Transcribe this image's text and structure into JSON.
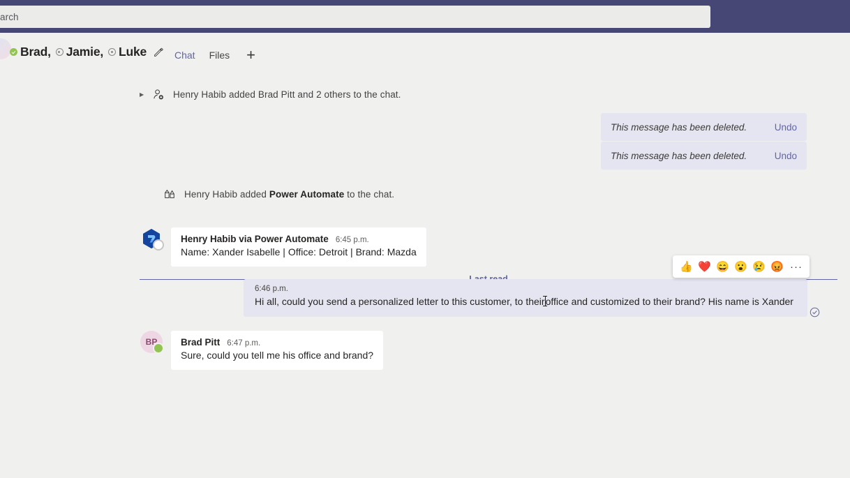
{
  "topbar": {
    "search": {
      "placeholder": "arch",
      "name": "search"
    },
    "accent_color": "#464775"
  },
  "chat_header": {
    "participants": [
      {
        "name": "Brad,",
        "presence": "available"
      },
      {
        "name": "Jamie,",
        "presence": "offline"
      },
      {
        "name": "Luke",
        "presence": "offline"
      }
    ],
    "edit_icon": "pencil-icon",
    "tabs": [
      {
        "label": "Chat",
        "active": true
      },
      {
        "label": "Files",
        "active": false
      }
    ],
    "add_tab_label": "+"
  },
  "messages": {
    "system_1": {
      "prefix": "Henry Habib added ",
      "bold": "Brad Pitt",
      "suffix": " and 2 others to the chat.",
      "full": "Henry Habib added Brad Pitt and 2 others to the chat.",
      "icon": "add-person-icon"
    },
    "system_2": {
      "prefix": "Henry Habib added ",
      "bold": "Power Automate",
      "suffix": " to the chat.",
      "icon": "app-icon"
    },
    "deleted_1": {
      "text": "This message has been deleted.",
      "undo": "Undo"
    },
    "deleted_2": {
      "text": "This message has been deleted.",
      "undo": "Undo"
    },
    "last_read": "Last read",
    "bot_message": {
      "sender": "Henry Habib via Power Automate",
      "time": "6:45 p.m.",
      "body": "Name: Xander Isabelle | Office: Detroit | Brand: Mazda",
      "avatar": "power-automate-logo",
      "presence": "unknown"
    },
    "outgoing": {
      "time": "6:46 p.m.",
      "body_before_caret": "Hi all, could you send a personalized letter to this customer, to their",
      "body_after_caret": "office and customized to their brand? His name is Xander",
      "seen_icon": "seen-check-icon"
    },
    "reply": {
      "sender": "Brad Pitt",
      "time": "6:47 p.m.",
      "body": "Sure, could you tell me his office and brand?",
      "avatar_initials": "BP",
      "presence": "available"
    }
  },
  "reaction_bar": {
    "reactions": [
      {
        "name": "thumbs-up-reaction",
        "glyph": "👍"
      },
      {
        "name": "heart-reaction",
        "glyph": "❤️"
      },
      {
        "name": "laugh-reaction",
        "glyph": "😄"
      },
      {
        "name": "surprised-reaction",
        "glyph": "😮"
      },
      {
        "name": "sad-reaction",
        "glyph": "😢"
      },
      {
        "name": "angry-reaction",
        "glyph": "😡"
      }
    ],
    "more": "···"
  },
  "colors": {
    "brand_purple": "#6264a7",
    "topbar": "#464775",
    "app_bg": "#f0f0ef",
    "bubble": "#ffffff",
    "own_bubble": "#e5e5f1",
    "available_green": "#92c353"
  }
}
